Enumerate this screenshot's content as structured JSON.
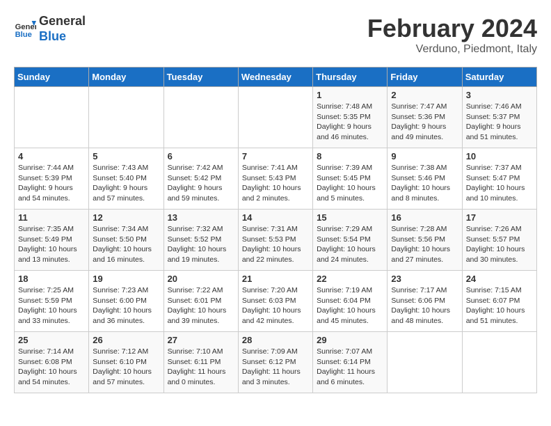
{
  "header": {
    "logo_line1": "General",
    "logo_line2": "Blue",
    "month_title": "February 2024",
    "subtitle": "Verduno, Piedmont, Italy"
  },
  "days_of_week": [
    "Sunday",
    "Monday",
    "Tuesday",
    "Wednesday",
    "Thursday",
    "Friday",
    "Saturday"
  ],
  "weeks": [
    [
      {
        "num": "",
        "info": ""
      },
      {
        "num": "",
        "info": ""
      },
      {
        "num": "",
        "info": ""
      },
      {
        "num": "",
        "info": ""
      },
      {
        "num": "1",
        "info": "Sunrise: 7:48 AM\nSunset: 5:35 PM\nDaylight: 9 hours and 46 minutes."
      },
      {
        "num": "2",
        "info": "Sunrise: 7:47 AM\nSunset: 5:36 PM\nDaylight: 9 hours and 49 minutes."
      },
      {
        "num": "3",
        "info": "Sunrise: 7:46 AM\nSunset: 5:37 PM\nDaylight: 9 hours and 51 minutes."
      }
    ],
    [
      {
        "num": "4",
        "info": "Sunrise: 7:44 AM\nSunset: 5:39 PM\nDaylight: 9 hours and 54 minutes."
      },
      {
        "num": "5",
        "info": "Sunrise: 7:43 AM\nSunset: 5:40 PM\nDaylight: 9 hours and 57 minutes."
      },
      {
        "num": "6",
        "info": "Sunrise: 7:42 AM\nSunset: 5:42 PM\nDaylight: 9 hours and 59 minutes."
      },
      {
        "num": "7",
        "info": "Sunrise: 7:41 AM\nSunset: 5:43 PM\nDaylight: 10 hours and 2 minutes."
      },
      {
        "num": "8",
        "info": "Sunrise: 7:39 AM\nSunset: 5:45 PM\nDaylight: 10 hours and 5 minutes."
      },
      {
        "num": "9",
        "info": "Sunrise: 7:38 AM\nSunset: 5:46 PM\nDaylight: 10 hours and 8 minutes."
      },
      {
        "num": "10",
        "info": "Sunrise: 7:37 AM\nSunset: 5:47 PM\nDaylight: 10 hours and 10 minutes."
      }
    ],
    [
      {
        "num": "11",
        "info": "Sunrise: 7:35 AM\nSunset: 5:49 PM\nDaylight: 10 hours and 13 minutes."
      },
      {
        "num": "12",
        "info": "Sunrise: 7:34 AM\nSunset: 5:50 PM\nDaylight: 10 hours and 16 minutes."
      },
      {
        "num": "13",
        "info": "Sunrise: 7:32 AM\nSunset: 5:52 PM\nDaylight: 10 hours and 19 minutes."
      },
      {
        "num": "14",
        "info": "Sunrise: 7:31 AM\nSunset: 5:53 PM\nDaylight: 10 hours and 22 minutes."
      },
      {
        "num": "15",
        "info": "Sunrise: 7:29 AM\nSunset: 5:54 PM\nDaylight: 10 hours and 24 minutes."
      },
      {
        "num": "16",
        "info": "Sunrise: 7:28 AM\nSunset: 5:56 PM\nDaylight: 10 hours and 27 minutes."
      },
      {
        "num": "17",
        "info": "Sunrise: 7:26 AM\nSunset: 5:57 PM\nDaylight: 10 hours and 30 minutes."
      }
    ],
    [
      {
        "num": "18",
        "info": "Sunrise: 7:25 AM\nSunset: 5:59 PM\nDaylight: 10 hours and 33 minutes."
      },
      {
        "num": "19",
        "info": "Sunrise: 7:23 AM\nSunset: 6:00 PM\nDaylight: 10 hours and 36 minutes."
      },
      {
        "num": "20",
        "info": "Sunrise: 7:22 AM\nSunset: 6:01 PM\nDaylight: 10 hours and 39 minutes."
      },
      {
        "num": "21",
        "info": "Sunrise: 7:20 AM\nSunset: 6:03 PM\nDaylight: 10 hours and 42 minutes."
      },
      {
        "num": "22",
        "info": "Sunrise: 7:19 AM\nSunset: 6:04 PM\nDaylight: 10 hours and 45 minutes."
      },
      {
        "num": "23",
        "info": "Sunrise: 7:17 AM\nSunset: 6:06 PM\nDaylight: 10 hours and 48 minutes."
      },
      {
        "num": "24",
        "info": "Sunrise: 7:15 AM\nSunset: 6:07 PM\nDaylight: 10 hours and 51 minutes."
      }
    ],
    [
      {
        "num": "25",
        "info": "Sunrise: 7:14 AM\nSunset: 6:08 PM\nDaylight: 10 hours and 54 minutes."
      },
      {
        "num": "26",
        "info": "Sunrise: 7:12 AM\nSunset: 6:10 PM\nDaylight: 10 hours and 57 minutes."
      },
      {
        "num": "27",
        "info": "Sunrise: 7:10 AM\nSunset: 6:11 PM\nDaylight: 11 hours and 0 minutes."
      },
      {
        "num": "28",
        "info": "Sunrise: 7:09 AM\nSunset: 6:12 PM\nDaylight: 11 hours and 3 minutes."
      },
      {
        "num": "29",
        "info": "Sunrise: 7:07 AM\nSunset: 6:14 PM\nDaylight: 11 hours and 6 minutes."
      },
      {
        "num": "",
        "info": ""
      },
      {
        "num": "",
        "info": ""
      }
    ]
  ]
}
